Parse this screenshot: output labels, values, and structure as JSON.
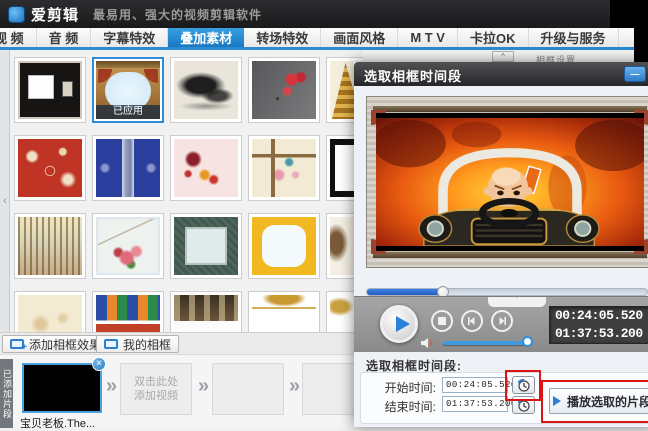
{
  "header": {
    "logo": "爱剪辑",
    "tagline": "最易用、强大的视频剪辑软件"
  },
  "tabs": [
    {
      "label": "视 频"
    },
    {
      "label": "音 频"
    },
    {
      "label": "字幕特效"
    },
    {
      "label": "叠加素材"
    },
    {
      "label": "转场特效"
    },
    {
      "label": "画面风格"
    },
    {
      "label": "M T V"
    },
    {
      "label": "卡拉OK"
    },
    {
      "label": "升级与服务"
    }
  ],
  "panel": {
    "header": "相框设置",
    "applied_badge": "已应用"
  },
  "toolbar": {
    "add_frame": "添加相框效果",
    "my_frames": "我的相框",
    "plus": "+"
  },
  "timeline": {
    "rail": "已添加片段",
    "clip_name": "宝贝老板.The...",
    "placeholder_line1": "双击此处",
    "placeholder_line2": "添加视频",
    "chevron": "»",
    "close": "×"
  },
  "dialog": {
    "title": "选取相框时间段",
    "minimize_glyph": "—",
    "collapse_glyph": "ˇ",
    "time_current": "00:24:05.520",
    "time_total": "01:37:53.200",
    "section_label": "选取相框时间段:",
    "start_label": "开始时间:",
    "start_value": "00:24:05.520",
    "end_label": "结束时间:",
    "end_value": "01:37:53.200",
    "play_segment_label": "播放选取的片段"
  },
  "icons": {
    "scroll_up": "^",
    "collapse_left": "‹"
  },
  "colors": {
    "accent_blue": "#1f8ad2",
    "highlight_red": "#dd1414",
    "progress_blue": "#2f6fd8",
    "titlebar_dark": "#2a2a2c"
  }
}
